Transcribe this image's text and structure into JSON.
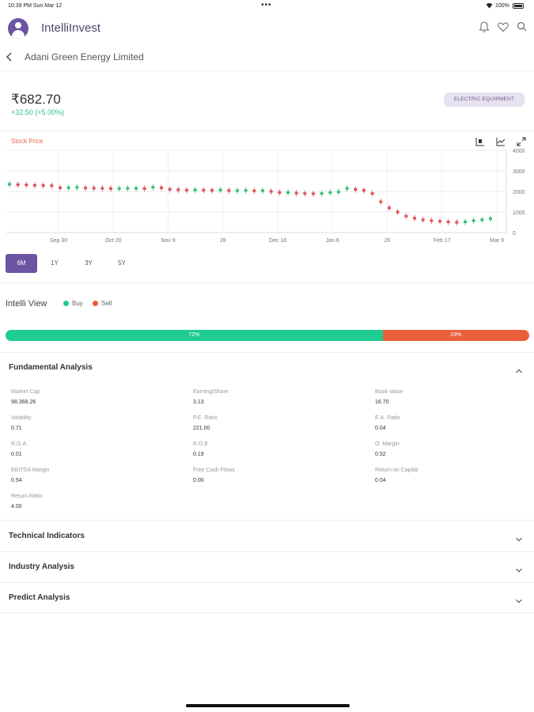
{
  "status_bar": {
    "time": "10:39 PM  Sun Mar 12",
    "dots": "•••",
    "battery": "100%"
  },
  "header": {
    "brand": "IntelliInvest",
    "icons": [
      "bell-icon",
      "heart-icon",
      "search-icon"
    ]
  },
  "stock": {
    "name": "Adani Green Energy Limited",
    "price": "₹682.70",
    "change": "+32.50 (+5.00%)",
    "sector": "ELECTRIC EQUIPMENT"
  },
  "chart": {
    "title": "Stock Price",
    "tools": [
      "candlestick-icon",
      "line-chart-icon",
      "expand-icon"
    ]
  },
  "chart_data": {
    "type": "line",
    "title": "Stock Price",
    "x_ticks": [
      "Sep 30",
      "Oct 20",
      "Nov 9",
      "28",
      "Dec 18",
      "Jan 6",
      "26",
      "Feb 17",
      "Mar 9"
    ],
    "y_ticks": [
      "4000",
      "3000",
      "2000",
      "1000",
      "0"
    ],
    "ylim": [
      0,
      4000
    ],
    "grid": true,
    "series": [
      {
        "values": [
          2350,
          2330,
          2320,
          2300,
          2290,
          2280,
          2180,
          2180,
          2200,
          2170,
          2160,
          2150,
          2140,
          2140,
          2150,
          2150,
          2140,
          2200,
          2180,
          2100,
          2080,
          2060,
          2070,
          2060,
          2050,
          2070,
          2040,
          2040,
          2050,
          2030,
          2040,
          2000,
          1950,
          1950,
          1920,
          1900,
          1890,
          1900,
          1950,
          1980,
          2150,
          2100,
          2050,
          1900,
          1500,
          1200,
          1000,
          800,
          700,
          620,
          580,
          550,
          520,
          500,
          520,
          580,
          620,
          682
        ]
      }
    ]
  },
  "ranges": [
    "6M",
    "1Y",
    "3Y",
    "5Y"
  ],
  "intelli_view": {
    "title": "Intelli View",
    "buy_label": "Buy",
    "sell_label": "Sell",
    "buy_pct_label": "72%",
    "sell_pct_label": "28%",
    "buy_fraction": 0.72,
    "buy_color": "#1fcc92",
    "sell_color": "#ea5e3a"
  },
  "fundamental": {
    "title": "Fundamental Analysis",
    "metrics": [
      {
        "label": "Market Cap",
        "value": "98,368.26"
      },
      {
        "label": "Earning/Share",
        "value": "3.13"
      },
      {
        "label": "Book Value",
        "value": "16.70"
      },
      {
        "label": "Volatility",
        "value": "0.71"
      },
      {
        "label": "P.E. Ratio",
        "value": "221.00"
      },
      {
        "label": "E.A. Ratio",
        "value": "0.04"
      },
      {
        "label": "R.O.A",
        "value": "0.01"
      },
      {
        "label": "R.O.E",
        "value": "0.19"
      },
      {
        "label": "O. Margin",
        "value": "0.52"
      },
      {
        "label": "EBITDA Margin",
        "value": "0.54"
      },
      {
        "label": "Free Cash Flows",
        "value": "0.00"
      },
      {
        "label": "Return on Capital",
        "value": "0.04"
      },
      {
        "label": "Return Ratio",
        "value": "4.00"
      }
    ]
  },
  "sections": [
    "Technical Indicators",
    "Industry Analysis",
    "Predict Analysis"
  ],
  "accent": "#6b54a3"
}
